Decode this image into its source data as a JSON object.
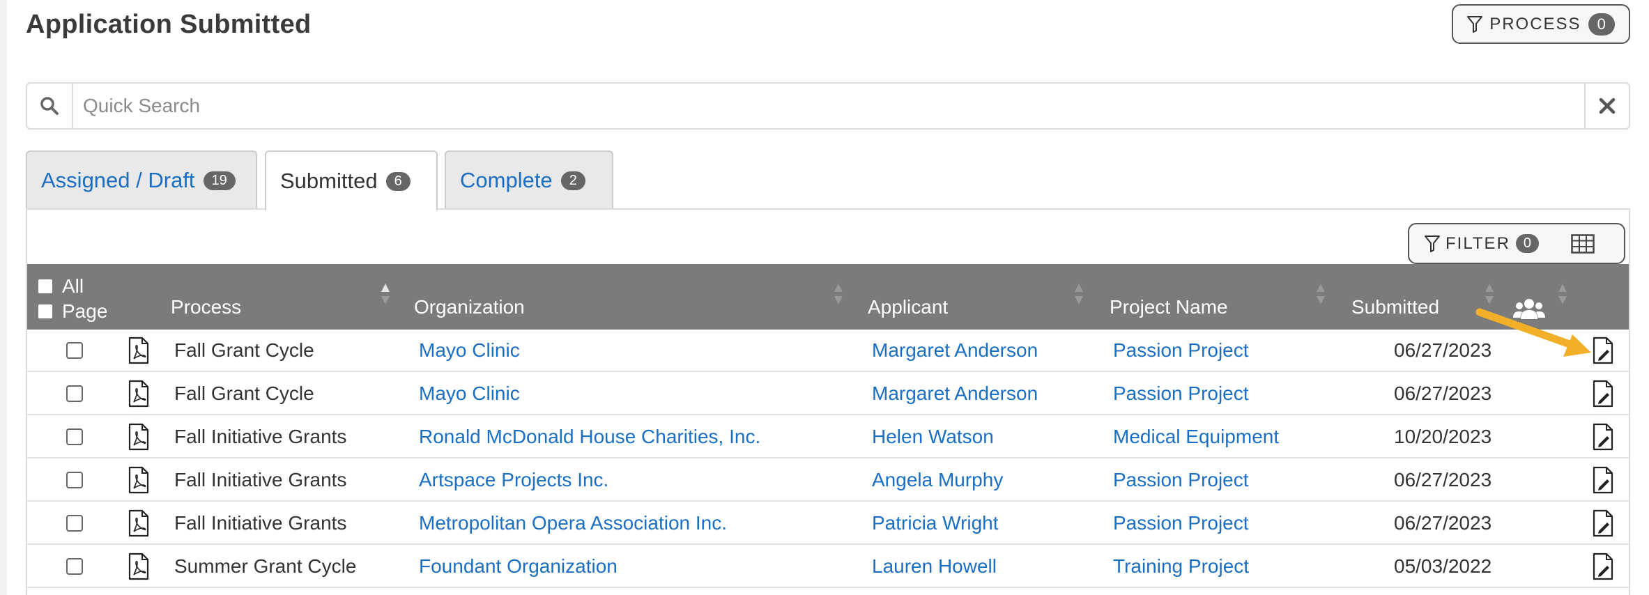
{
  "page": {
    "title": "Application Submitted"
  },
  "process_button": {
    "label": "PROCESS",
    "count": "0"
  },
  "search": {
    "placeholder": "Quick Search",
    "value": ""
  },
  "tabs": [
    {
      "label": "Assigned / Draft",
      "count": "19",
      "active": false
    },
    {
      "label": "Submitted",
      "count": "6",
      "active": true
    },
    {
      "label": "Complete",
      "count": "2",
      "active": false
    }
  ],
  "filter_button": {
    "label": "FILTER",
    "count": "0"
  },
  "table": {
    "select_all_label": "All",
    "select_page_label": "Page",
    "columns": {
      "process": "Process",
      "organization": "Organization",
      "applicant": "Applicant",
      "project_name": "Project Name",
      "submitted": "Submitted"
    },
    "rows": [
      {
        "process": "Fall Grant Cycle",
        "organization": "Mayo Clinic",
        "applicant": "Margaret Anderson",
        "project_name": "Passion Project",
        "submitted": "06/27/2023"
      },
      {
        "process": "Fall Grant Cycle",
        "organization": "Mayo Clinic",
        "applicant": "Margaret Anderson",
        "project_name": "Passion Project",
        "submitted": "06/27/2023"
      },
      {
        "process": "Fall Initiative Grants",
        "organization": "Ronald McDonald House Charities, Inc.",
        "applicant": "Helen Watson",
        "project_name": "Medical Equipment",
        "submitted": "10/20/2023"
      },
      {
        "process": "Fall Initiative Grants",
        "organization": "Artspace Projects Inc.",
        "applicant": "Angela Murphy",
        "project_name": "Passion Project",
        "submitted": "06/27/2023"
      },
      {
        "process": "Fall Initiative Grants",
        "organization": "Metropolitan Opera Association Inc.",
        "applicant": "Patricia Wright",
        "project_name": "Passion Project",
        "submitted": "06/27/2023"
      },
      {
        "process": "Summer Grant Cycle",
        "organization": "Foundant Organization",
        "applicant": "Lauren Howell",
        "project_name": "Training Project",
        "submitted": "05/03/2022"
      }
    ]
  },
  "icons": {
    "search": "search-icon",
    "clear": "close-icon",
    "filter": "filter-icon",
    "columns": "table-columns-icon",
    "team": "users-icon",
    "pdf": "pdf-file-icon",
    "edit": "edit-document-icon"
  },
  "colors": {
    "link": "#1a6fc4",
    "header_bg": "#7b7b7b",
    "badge_bg": "#666666",
    "annotation_arrow": "#f2b02a"
  }
}
